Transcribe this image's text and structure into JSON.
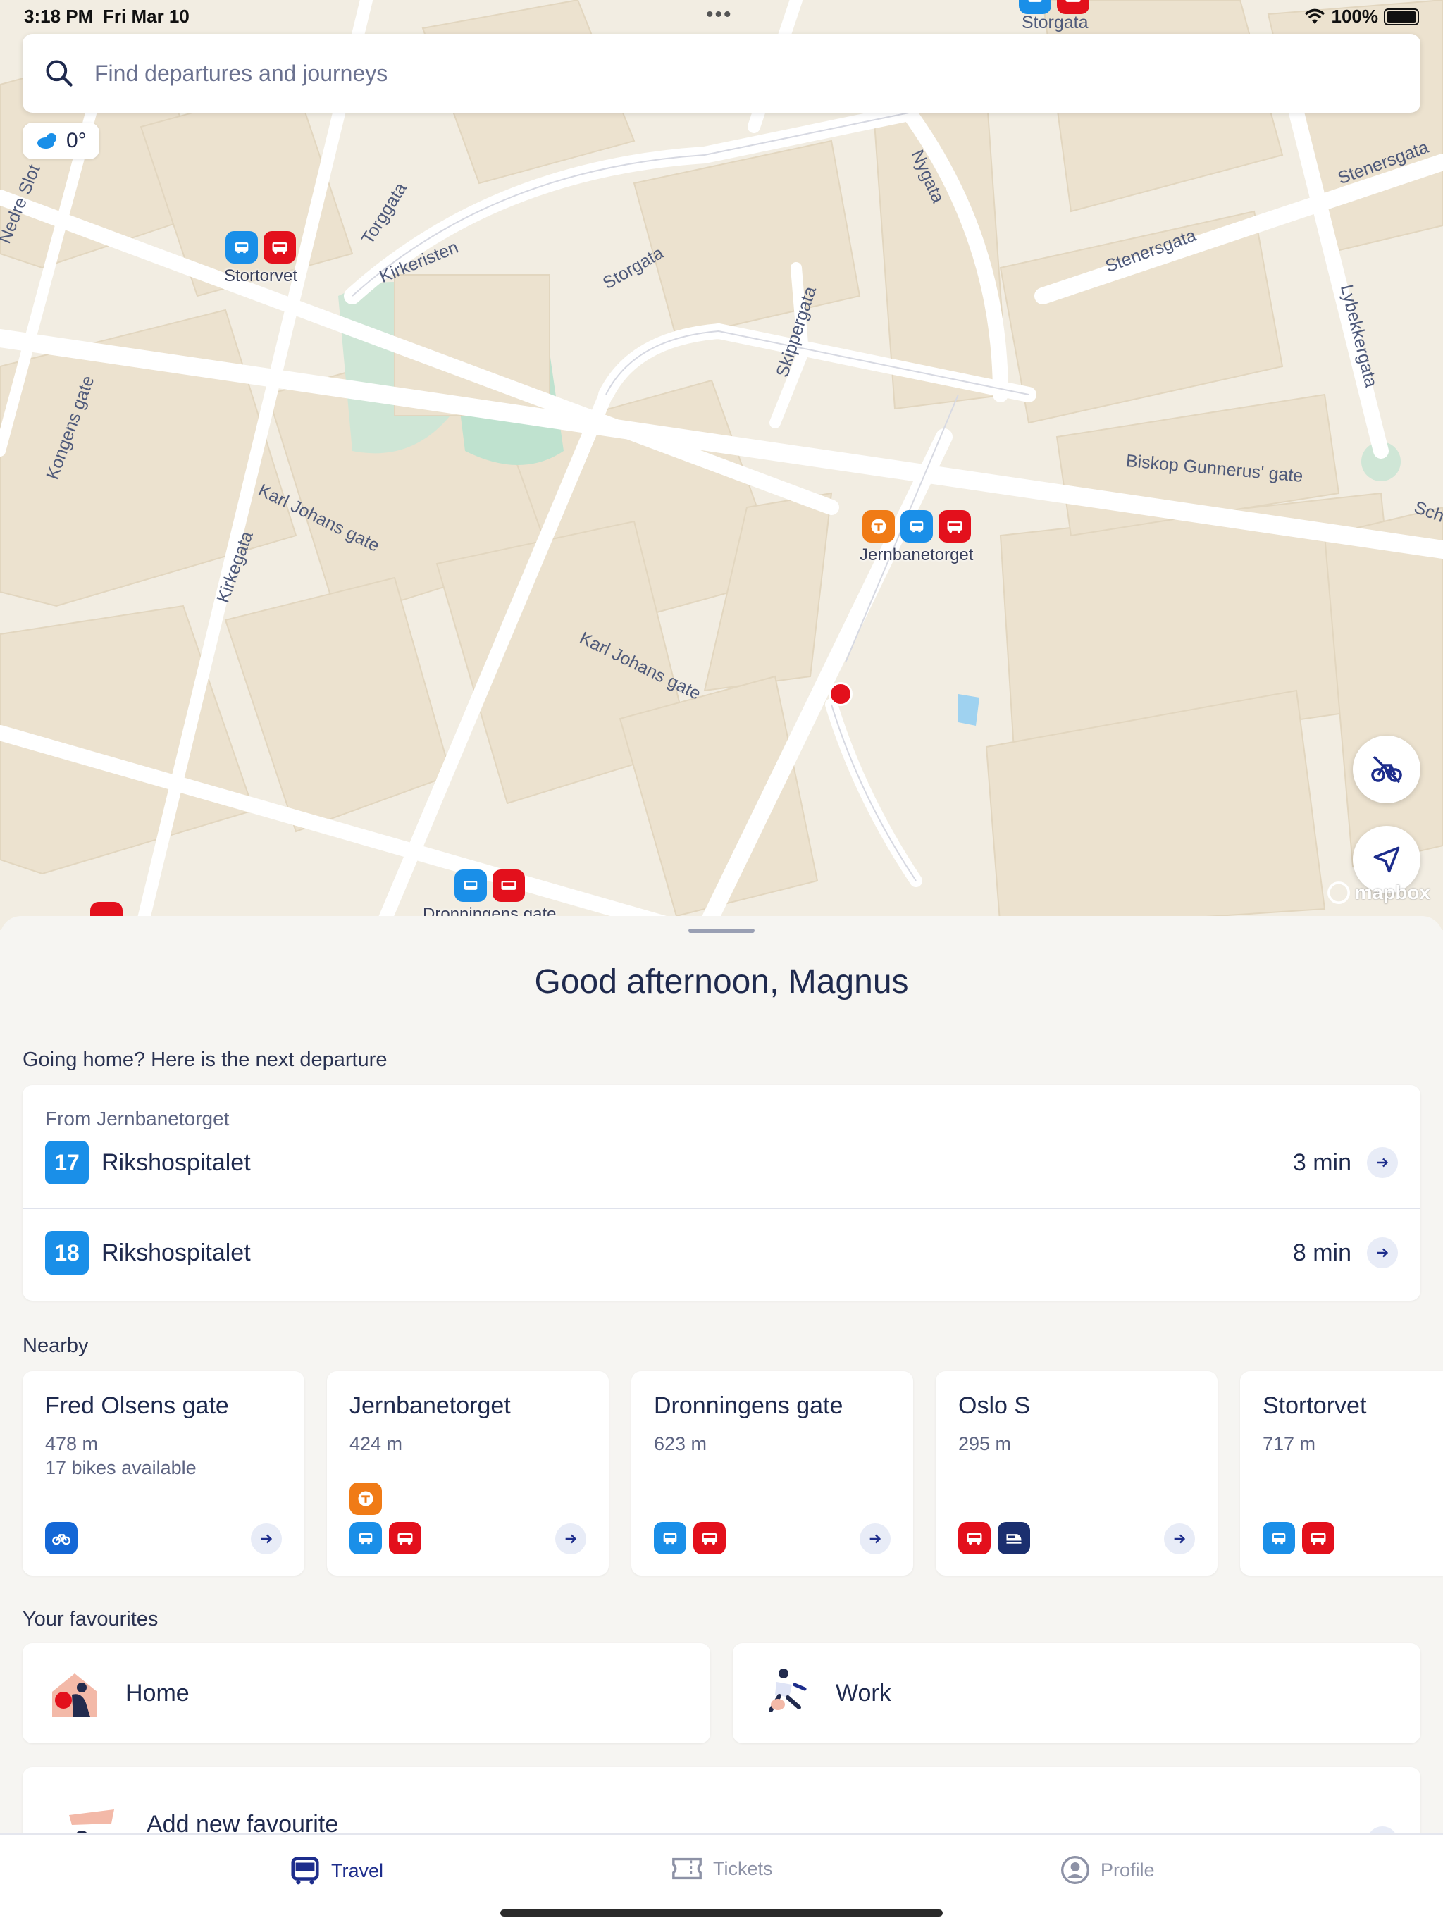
{
  "status_bar": {
    "time": "3:18 PM",
    "date": "Fri Mar 10",
    "battery": "100%"
  },
  "search": {
    "placeholder": "Find departures and journeys"
  },
  "weather": {
    "temperature": "0°"
  },
  "map": {
    "attribution": "mapbox",
    "streets": [
      "Storgata",
      "Torggata",
      "Kirkeristen",
      "Storgata",
      "Nygata",
      "Stenersgata",
      "Stenersgata",
      "Lybekkergata",
      "Skippergata",
      "Biskop Gunnerus' gate",
      "Kongens gate",
      "Karl Johans gate",
      "Kirkegata",
      "Karl Johans gate",
      "Nedre Slot",
      "Sch"
    ],
    "stops": [
      {
        "name": "Stortorvet",
        "modes": [
          "tram",
          "bus"
        ]
      },
      {
        "name": "Jernbanetorget",
        "modes": [
          "metro",
          "tram",
          "bus"
        ]
      },
      {
        "name": "Storgata",
        "modes": [
          "tram",
          "bus"
        ]
      },
      {
        "name": "Dronningens gate",
        "modes": [
          "tram",
          "bus"
        ]
      }
    ]
  },
  "greeting": "Good afternoon, Magnus",
  "going_home": {
    "title": "Going home? Here is the next departure",
    "from": "From Jernbanetorget",
    "departures": [
      {
        "line": "17",
        "destination": "Rikshospitalet",
        "time": "3 min"
      },
      {
        "line": "18",
        "destination": "Rikshospitalet",
        "time": "8 min"
      }
    ]
  },
  "nearby": {
    "title": "Nearby",
    "items": [
      {
        "name": "Fred Olsens gate",
        "distance": "478 m",
        "extra": "17 bikes available",
        "modes": [
          "bike"
        ]
      },
      {
        "name": "Jernbanetorget",
        "distance": "424 m",
        "extra": "",
        "modes": [
          "metro",
          "tram",
          "bus"
        ]
      },
      {
        "name": "Dronningens gate",
        "distance": "623 m",
        "extra": "",
        "modes": [
          "tram",
          "bus"
        ]
      },
      {
        "name": "Oslo S",
        "distance": "295 m",
        "extra": "",
        "modes": [
          "bus",
          "train"
        ]
      },
      {
        "name": "Stortorvet",
        "distance": "717 m",
        "extra": "",
        "modes": [
          "tram",
          "bus"
        ]
      }
    ]
  },
  "favourites": {
    "title": "Your favourites",
    "items": [
      {
        "label": "Home"
      },
      {
        "label": "Work"
      }
    ],
    "add_label": "Add new favourite"
  },
  "tabs": [
    {
      "label": "Travel",
      "active": true
    },
    {
      "label": "Tickets",
      "active": false
    },
    {
      "label": "Profile",
      "active": false
    }
  ],
  "colors": {
    "tram": "#1a8fe8",
    "bus": "#e3101c",
    "metro": "#f07b16",
    "train": "#1b2f6f",
    "bike": "#1467d6",
    "accent": "#1d2d8c"
  }
}
